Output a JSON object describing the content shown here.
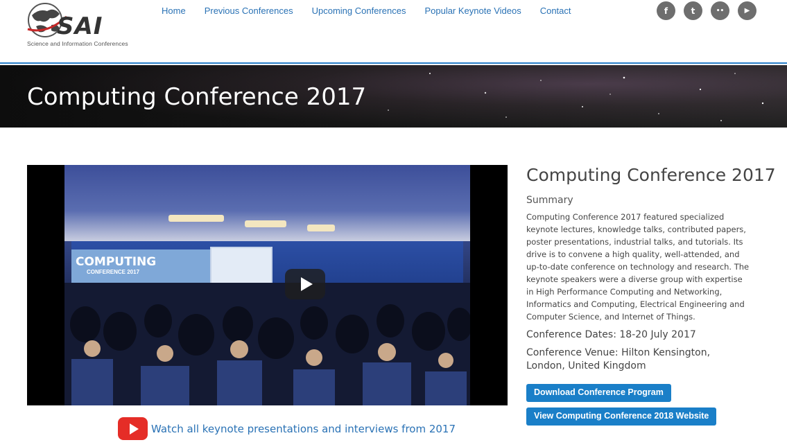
{
  "brand": {
    "logo_text": "SAI",
    "tagline": "Science and Information Conferences"
  },
  "nav": {
    "items": [
      {
        "label": "Home"
      },
      {
        "label": "Previous Conferences"
      },
      {
        "label": "Upcoming Conferences"
      },
      {
        "label": "Popular Keynote Videos"
      },
      {
        "label": "Contact"
      }
    ]
  },
  "social": {
    "icons": [
      {
        "name": "facebook-icon",
        "glyph": "f"
      },
      {
        "name": "twitter-icon",
        "glyph": "t"
      },
      {
        "name": "flickr-icon",
        "glyph": "••"
      },
      {
        "name": "youtube-icon",
        "glyph": "▶"
      }
    ]
  },
  "banner": {
    "title": "Computing Conference 2017"
  },
  "video": {
    "sign_title": "COMPUTING",
    "sign_subtitle": "CONFERENCE 2017"
  },
  "keynote_link": {
    "text": "Watch all keynote presentations and interviews from 2017"
  },
  "info": {
    "title": "Computing Conference 2017",
    "summary_heading": "Summary",
    "summary": "Computing Conference 2017 featured specialized keynote lectures, knowledge talks, contributed papers, poster presentations, industrial talks, and tutorials. Its drive is to convene a high quality, well-attended, and up-to-date conference on technology and research. The keynote speakers were a diverse group with expertise in High Performance Computing and Networking, Informatics and Computing, Electrical Engineering and Computer Science, and Internet of Things.",
    "dates": "Conference Dates: 18-20 July 2017",
    "venue": "Conference Venue: Hilton Kensington, London, United Kingdom",
    "download_button": "Download Conference Program",
    "website_button": "View Computing Conference 2018 Website"
  },
  "colors": {
    "link": "#2a72b5",
    "button": "#1a7fc8",
    "header_border": "#2a7fc9",
    "youtube_red": "#e52d27"
  }
}
